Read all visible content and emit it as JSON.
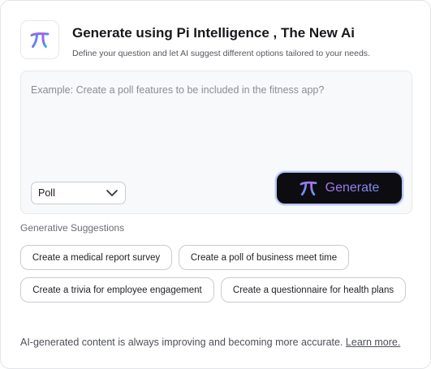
{
  "header": {
    "title": "Generate using Pi Intelligence , The New Ai",
    "subtitle": "Define your question and let AI suggest different options tailored to your needs.",
    "logo_icon": "pi-icon"
  },
  "prompt": {
    "placeholder": "Example: Create a poll features to be included in the fitness app?",
    "value": ""
  },
  "type_select": {
    "selected": "Poll"
  },
  "generate_button": {
    "label": "Generate",
    "icon": "pi-icon"
  },
  "suggestions": {
    "heading": "Generative Suggestions",
    "items": [
      "Create a medical report survey",
      "Create a poll of business meet time",
      "Create a trivia for employee engagement",
      "Create a questionnaire for health plans"
    ]
  },
  "footer": {
    "text": "AI-generated content is always improving and becoming more accurate.",
    "link_label": "Learn more."
  },
  "colors": {
    "accent_gradient_start": "#8b6cf0",
    "accent_gradient_end": "#3fb7e6",
    "generate_bg": "#0d0d11"
  }
}
